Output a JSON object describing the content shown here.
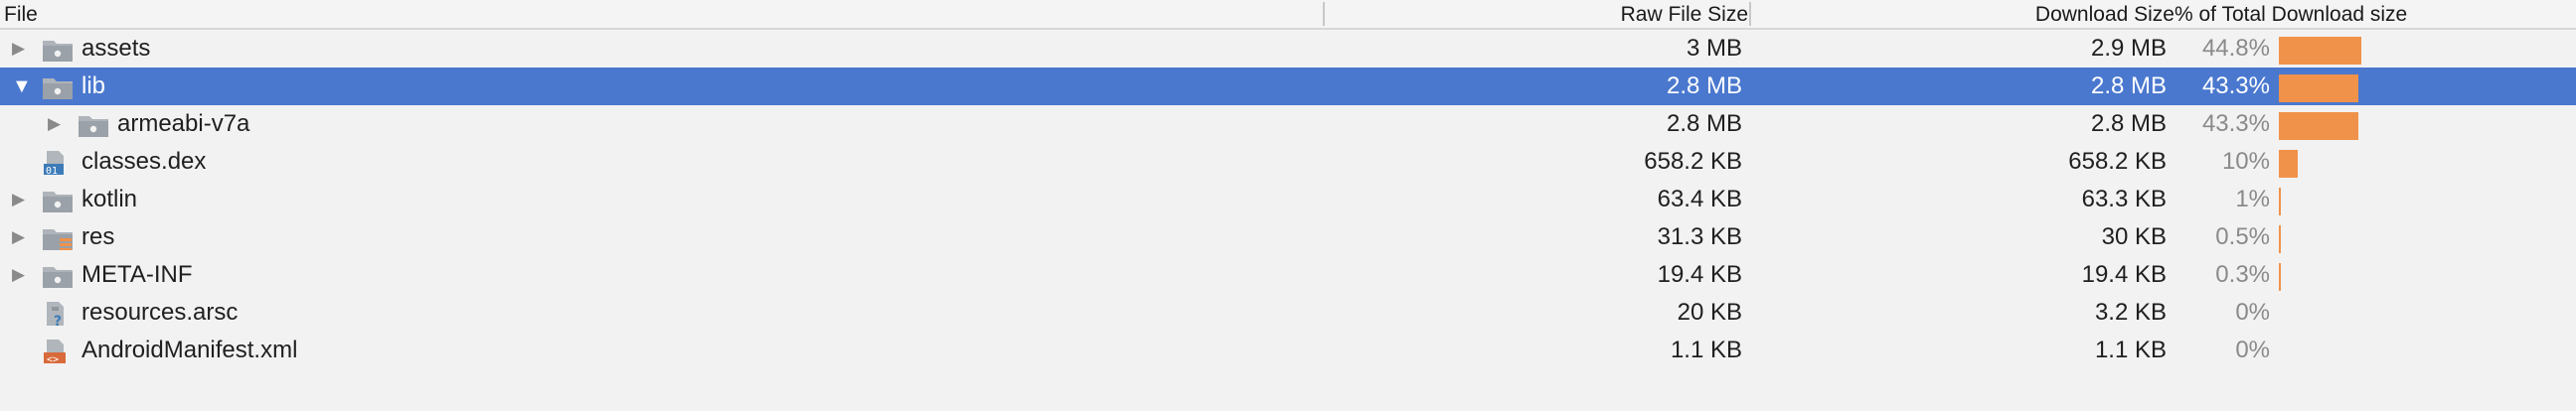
{
  "columns": {
    "file": "File",
    "raw_size": "Raw File Size",
    "download_size": "Download Size",
    "percent": "% of Total Download size"
  },
  "rows": [
    {
      "name": "assets",
      "raw": "3 MB",
      "download": "2.9 MB",
      "percent": "44.8%",
      "share": 0.448,
      "icon": "folder-icon",
      "expander": "collapsed",
      "depth": 0,
      "selected": false
    },
    {
      "name": "lib",
      "raw": "2.8 MB",
      "download": "2.8 MB",
      "percent": "43.3%",
      "share": 0.433,
      "icon": "folder-icon",
      "expander": "expanded",
      "depth": 0,
      "selected": true
    },
    {
      "name": "armeabi-v7a",
      "raw": "2.8 MB",
      "download": "2.8 MB",
      "percent": "43.3%",
      "share": 0.433,
      "icon": "folder-icon",
      "expander": "collapsed",
      "depth": 1,
      "selected": false
    },
    {
      "name": "classes.dex",
      "raw": "658.2 KB",
      "download": "658.2 KB",
      "percent": "10%",
      "share": 0.1,
      "icon": "dex-file-icon",
      "expander": "none",
      "depth": 0,
      "selected": false
    },
    {
      "name": "kotlin",
      "raw": "63.4 KB",
      "download": "63.3 KB",
      "percent": "1%",
      "share": 0.01,
      "icon": "folder-icon",
      "expander": "collapsed",
      "depth": 0,
      "selected": false
    },
    {
      "name": "res",
      "raw": "31.3 KB",
      "download": "30 KB",
      "percent": "0.5%",
      "share": 0.005,
      "icon": "resource-folder-icon",
      "expander": "collapsed",
      "depth": 0,
      "selected": false
    },
    {
      "name": "META-INF",
      "raw": "19.4 KB",
      "download": "19.4 KB",
      "percent": "0.3%",
      "share": 0.003,
      "icon": "folder-icon",
      "expander": "collapsed",
      "depth": 0,
      "selected": false
    },
    {
      "name": "resources.arsc",
      "raw": "20 KB",
      "download": "3.2 KB",
      "percent": "0%",
      "share": 0.0,
      "icon": "unknown-file-icon",
      "expander": "none",
      "depth": 0,
      "selected": false
    },
    {
      "name": "AndroidManifest.xml",
      "raw": "1.1 KB",
      "download": "1.1 KB",
      "percent": "0%",
      "share": 0.0,
      "icon": "xml-file-icon",
      "expander": "none",
      "depth": 0,
      "selected": false
    }
  ],
  "colors": {
    "selection": "#4a78cf",
    "bar": "#f0924a",
    "folder": "#aeb4ba"
  }
}
